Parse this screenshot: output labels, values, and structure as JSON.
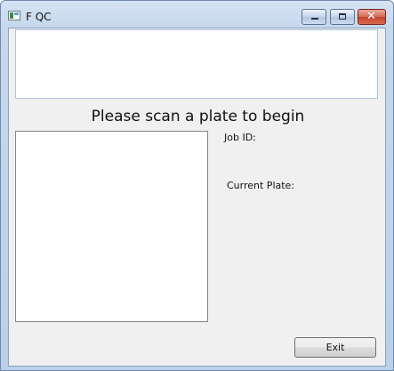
{
  "window": {
    "title": "F QC"
  },
  "titlebar": {
    "close_glyph": "✕"
  },
  "main": {
    "prompt": "Please scan a plate to begin",
    "job_id_label": "Job ID:",
    "current_plate_label": "Current Plate:"
  },
  "footer": {
    "exit_label": "Exit"
  },
  "icons": {
    "app": "app-icon",
    "minimize": "minimize-icon",
    "maximize": "maximize-icon",
    "close": "close-icon"
  }
}
